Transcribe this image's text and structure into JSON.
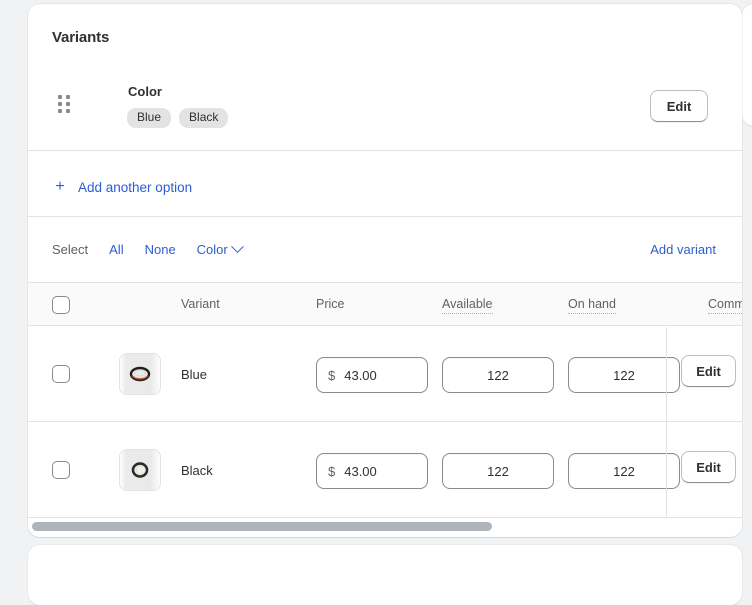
{
  "colors": {
    "page_bg": "#f1f2f4",
    "card_bg": "#ffffff",
    "link": "#2c5ecf",
    "text": "#303030",
    "subdued": "#616161",
    "border": "#e3e3e3",
    "pill_bg": "#e3e3e3",
    "scrollbar": "#aeb4ba"
  },
  "card": {
    "title": "Variants"
  },
  "option": {
    "drag_handle_icon": "drag-dots-icon",
    "name": "Color",
    "values": [
      "Blue",
      "Black"
    ],
    "edit_label": "Edit"
  },
  "add_option": {
    "plus_icon": "plus-icon",
    "label": "Add another option"
  },
  "select_bar": {
    "label": "Select",
    "links": [
      "All",
      "None"
    ],
    "dropdown_label": "Color",
    "dropdown_icon": "chevron-down-icon",
    "add_variant_label": "Add variant"
  },
  "table": {
    "columns": [
      {
        "key": "select",
        "label": "",
        "dotted": false
      },
      {
        "key": "variant",
        "label": "Variant",
        "dotted": false
      },
      {
        "key": "price",
        "label": "Price",
        "dotted": false
      },
      {
        "key": "available",
        "label": "Available",
        "dotted": true
      },
      {
        "key": "on_hand",
        "label": "On hand",
        "dotted": true
      },
      {
        "key": "committed",
        "label": "Commi",
        "dotted": true
      }
    ],
    "rows": [
      {
        "variant": "Blue",
        "thumbnail_icon": "ring-product-thumbnail",
        "currency_symbol": "$",
        "price": "43.00",
        "available": "122",
        "on_hand": "122",
        "edit_label": "Edit",
        "selected": false
      },
      {
        "variant": "Black",
        "thumbnail_icon": "ring-product-thumbnail",
        "currency_symbol": "$",
        "price": "43.00",
        "available": "122",
        "on_hand": "122",
        "edit_label": "Edit",
        "selected": false
      }
    ],
    "select_all_checked": false
  },
  "scrollbar": {
    "orientation": "horizontal",
    "position_percent": 0
  }
}
